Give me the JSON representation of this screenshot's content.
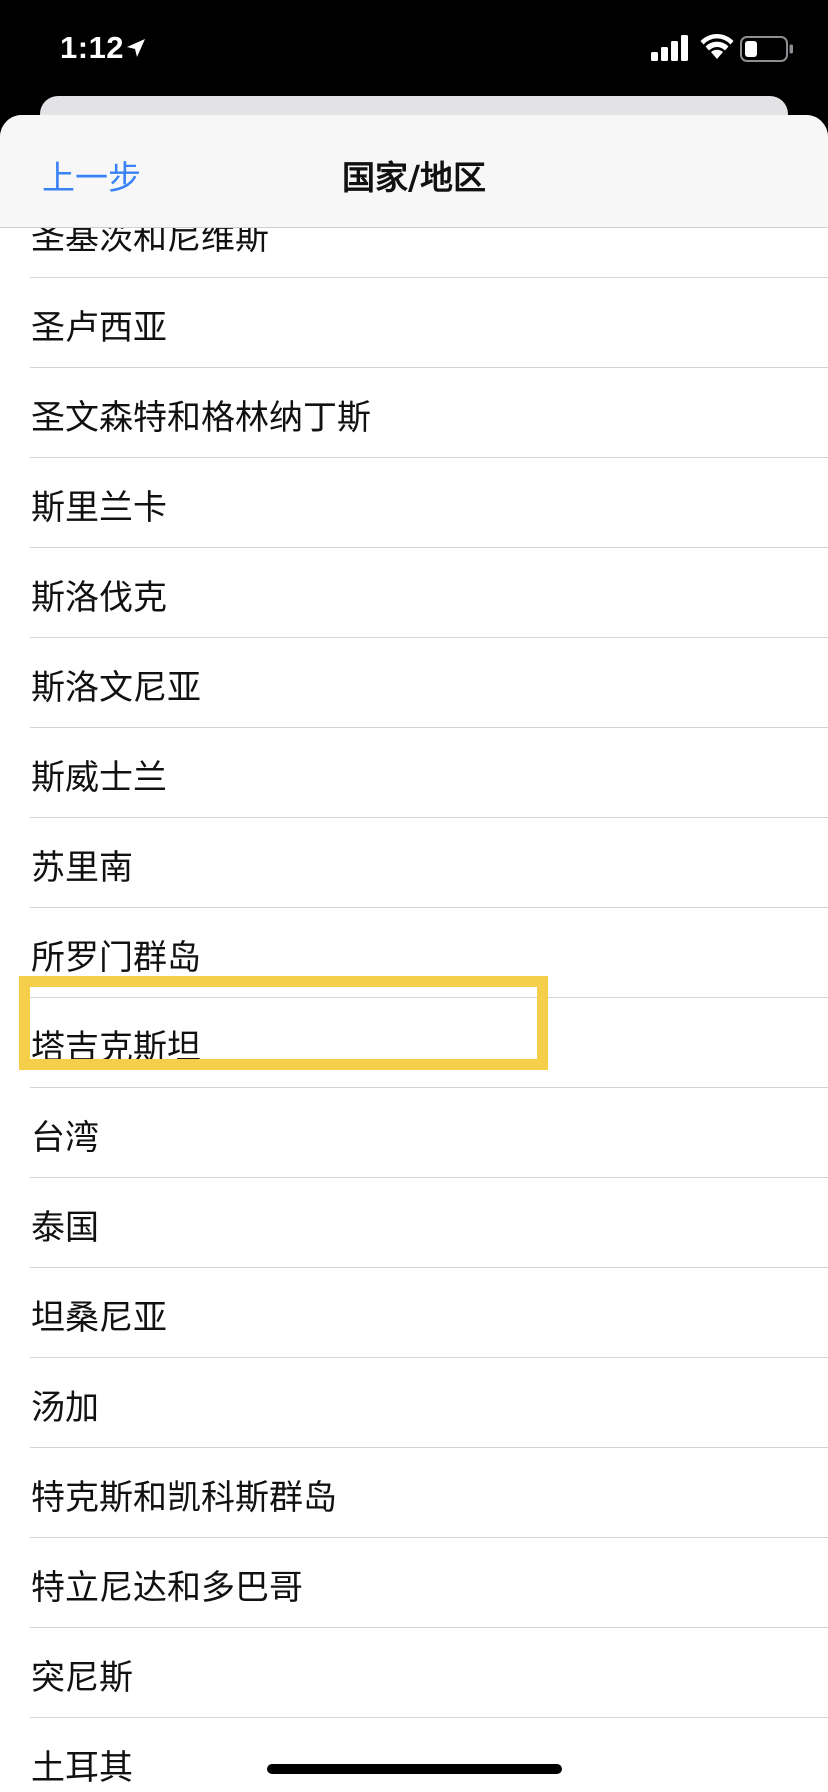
{
  "status_bar": {
    "time": "1:12"
  },
  "nav": {
    "back_label": "上一步",
    "title": "国家/地区"
  },
  "countries": [
    "圣基茨和尼维斯",
    "圣卢西亚",
    "圣文森特和格林纳丁斯",
    "斯里兰卡",
    "斯洛伐克",
    "斯洛文尼亚",
    "斯威士兰",
    "苏里南",
    "所罗门群岛",
    "塔吉克斯坦",
    "台湾",
    "泰国",
    "坦桑尼亚",
    "汤加",
    "特克斯和凯科斯群岛",
    "特立尼达和多巴哥",
    "突尼斯",
    "土耳其"
  ],
  "colors": {
    "accent": "#3a82f7",
    "highlight": "#f5cf4a"
  },
  "icons": {
    "location": "location-arrow-icon",
    "signal": "cellular-signal-icon",
    "wifi": "wifi-icon",
    "battery": "battery-icon"
  }
}
